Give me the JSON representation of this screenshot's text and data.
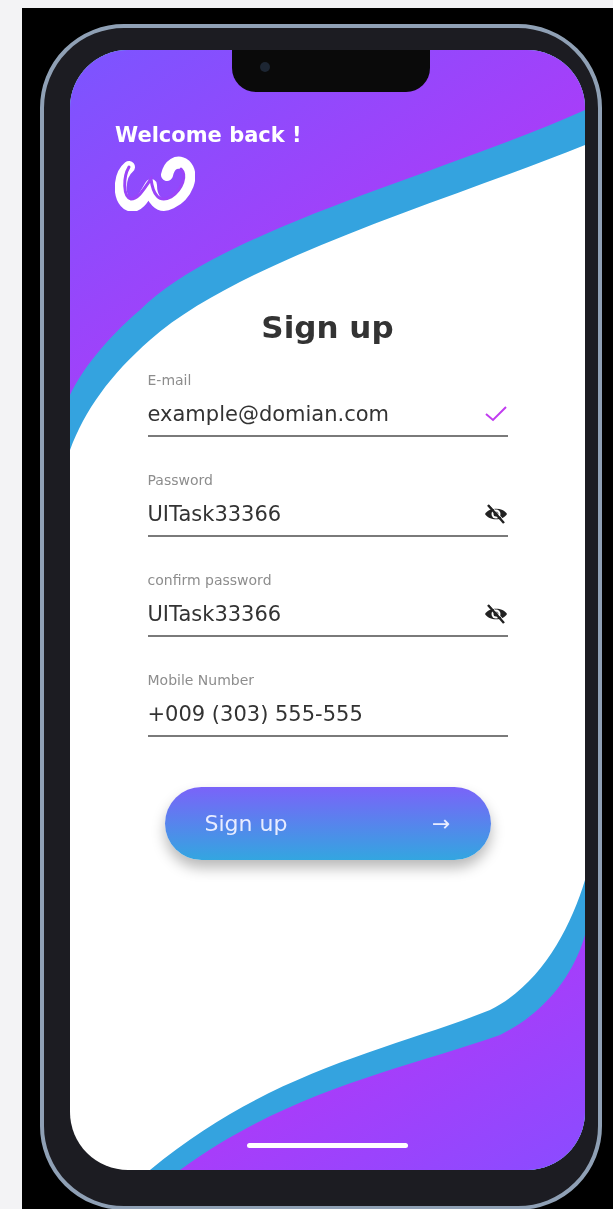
{
  "header": {
    "greeting": "Welcome back !"
  },
  "title": "Sign up",
  "fields": [
    {
      "label": "E-mail",
      "value": "example@domian.com",
      "kind": "check"
    },
    {
      "label": "Password",
      "value": "UITask33366",
      "kind": "eye"
    },
    {
      "label": "confirm password",
      "value": "UITask33366",
      "kind": "eye"
    },
    {
      "label": "Mobile Number",
      "value": "+009 (303) 555-555",
      "kind": "plain"
    }
  ],
  "submit": {
    "label": "Sign up",
    "icon": "→"
  }
}
